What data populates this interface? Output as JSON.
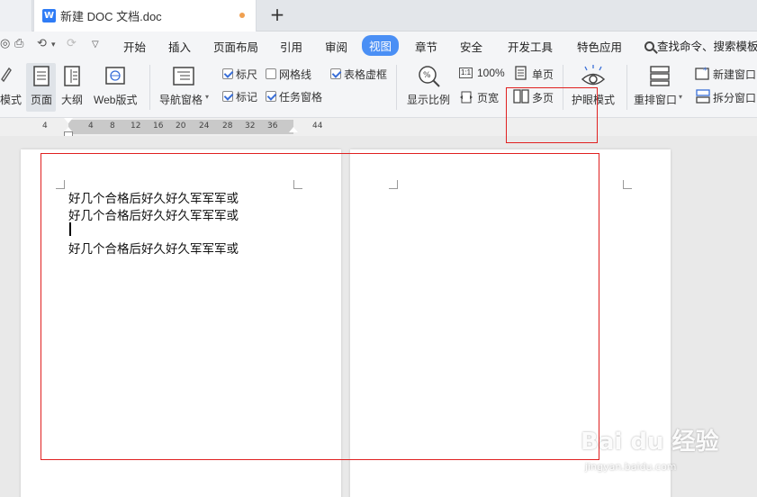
{
  "tabs": {
    "active_doc_title": "新建 DOC 文档.doc",
    "new_tab_symbol": "+"
  },
  "menubar": {
    "quick_access": [
      "⟲",
      "▾",
      "⟳",
      "▽"
    ],
    "items": [
      "开始",
      "插入",
      "页面布局",
      "引用",
      "审阅",
      "视图",
      "章节",
      "安全",
      "开发工具",
      "特色应用"
    ],
    "active_item": "视图",
    "search_label": "查找命令、搜索模板"
  },
  "ribbon": {
    "views": {
      "mode_partial": "模式",
      "page": "页面",
      "outline": "大纲",
      "web": "Web版式"
    },
    "nav_pane": "导航窗格",
    "checkboxes": {
      "ruler": {
        "label": "标尺",
        "checked": true
      },
      "gridlines": {
        "label": "网格线",
        "checked": false
      },
      "table_gridlines": {
        "label": "表格虚框",
        "checked": true
      },
      "marks": {
        "label": "标记",
        "checked": true
      },
      "task_pane": {
        "label": "任务窗格",
        "checked": true
      }
    },
    "zoom": {
      "label": "显示比例",
      "percent_icon": "1:1",
      "percent": "100%",
      "page_width": "页宽",
      "single_page": "单页",
      "multi_page": "多页"
    },
    "eye_mode": "护眼模式",
    "arrange_windows": "重排窗口",
    "new_window": "新建窗口",
    "split_window": "拆分窗口"
  },
  "ruler": {
    "numbers": [
      "4",
      "4",
      "8",
      "12",
      "16",
      "20",
      "24",
      "28",
      "32",
      "36",
      "44"
    ]
  },
  "document": {
    "lines": [
      "好几个合格后好久好久军军军或",
      "好几个合格后好久好久军军军或",
      "好几个合格后好久好久军军军或"
    ]
  },
  "watermark": {
    "main": "Bai du 经验",
    "sub": "jingyan.baidu.com"
  },
  "colors": {
    "accent": "#4a8ff5",
    "highlight": "#e02020",
    "word_icon": "#2f7cf6"
  }
}
